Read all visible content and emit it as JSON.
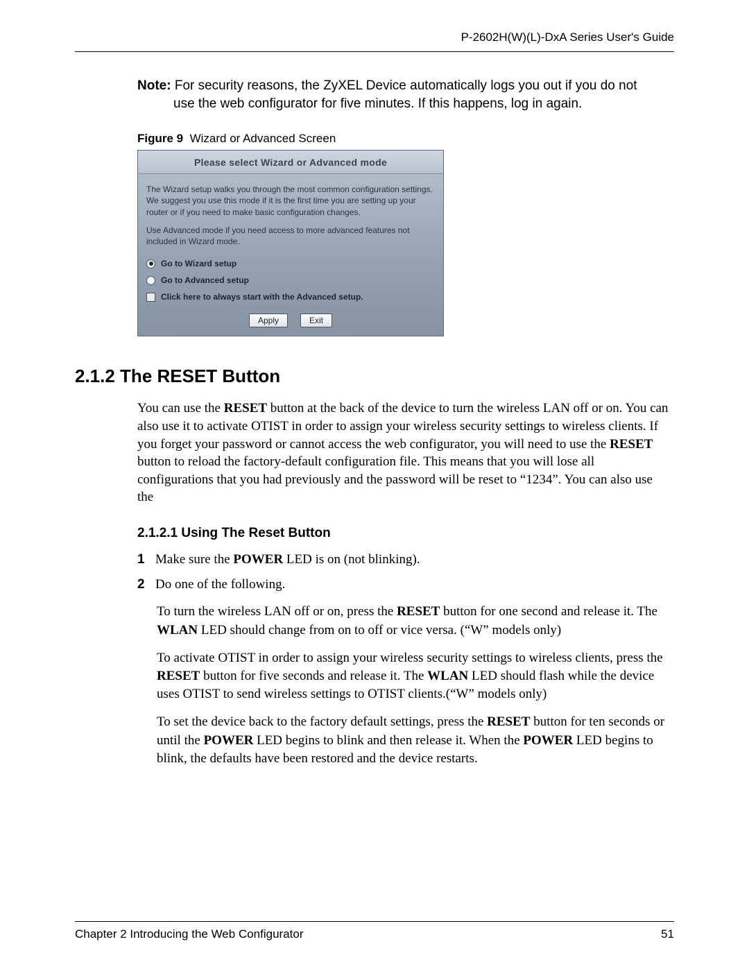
{
  "header": {
    "running": "P-2602H(W)(L)-DxA Series User's Guide"
  },
  "note": {
    "label": "Note:",
    "line1": " For security reasons, the ZyXEL Device automatically logs you out if you do not",
    "line2": "use the web configurator for five minutes. If this happens, log in again."
  },
  "figure": {
    "label": "Figure 9",
    "caption": "Wizard or Advanced Screen",
    "dlg": {
      "title": "Please select Wizard or Advanced mode",
      "para1": "The Wizard setup walks you through the most common configuration settings. We suggest you use this mode if it is the first time you are setting up your router or if you need to make basic configuration changes.",
      "para2": "Use Advanced mode if you need access to more advanced features not included in Wizard mode.",
      "opt_wizard": "Go to Wizard setup",
      "opt_advanced": "Go to Advanced setup",
      "opt_always": "Click here to always start with the Advanced setup.",
      "btn_apply": "Apply",
      "btn_exit": "Exit"
    }
  },
  "section": {
    "h2": "2.1.2  The RESET Button",
    "p1_a": "You can use the ",
    "p1_b": "RESET",
    "p1_c": " button at the back of the device to turn the wireless LAN off or on. You can also use it to activate OTIST in order to assign your wireless security settings to wireless clients. If you forget your password or cannot access the web configurator, you will need to use the ",
    "p1_d": "RESET",
    "p1_e": " button to reload the factory-default configuration file. This means that you will lose all configurations that you had previously and the password will be reset to “1234”. You can also use the"
  },
  "subsection": {
    "h3": "2.1.2.1  Using The Reset Button",
    "step1_num": "1",
    "step1_a": "Make sure the ",
    "step1_b": "POWER",
    "step1_c": " LED is on (not blinking).",
    "step2_num": "2",
    "step2_text": "Do one of the following.",
    "para_a1": "To turn the wireless LAN off or on, press the ",
    "para_a2": "RESET",
    "para_a3": " button for one second and release it. The ",
    "para_a4": "WLAN",
    "para_a5": " LED should change from on to off or vice versa. (“W” models only)",
    "para_b1": "To activate OTIST in order to assign your wireless security settings to wireless clients, press the ",
    "para_b2": "RESET",
    "para_b3": " button for five seconds and release it. The ",
    "para_b4": "WLAN",
    "para_b5": " LED should flash while the device uses OTIST to send wireless settings to OTIST clients.(“W” models only)",
    "para_c1": "To set the device back to the factory default settings, press the ",
    "para_c2": "RESET",
    "para_c3": " button for ten seconds or until the ",
    "para_c4": "POWER",
    "para_c5": " LED begins to blink and then release it. When the ",
    "para_c6": "POWER",
    "para_c7": " LED begins to blink, the defaults have been restored and the device restarts."
  },
  "footer": {
    "left": "Chapter 2 Introducing the Web Configurator",
    "right": "51"
  }
}
